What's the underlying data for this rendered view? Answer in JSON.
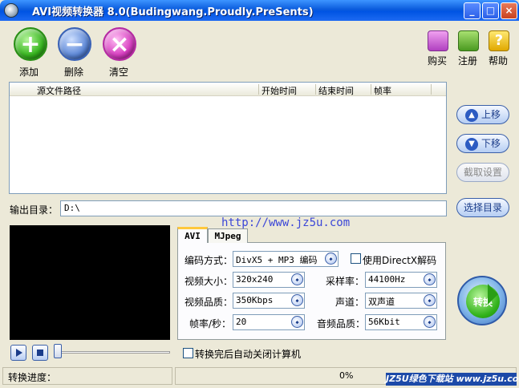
{
  "window": {
    "title": "AVI视频转换器 8.0(Budingwang.Proudly.PreSents)",
    "min_glyph": "_",
    "max_glyph": "□",
    "close_glyph": "×"
  },
  "toolbar": {
    "add_glyph": "+",
    "del_glyph": "−",
    "clr_glyph": "×",
    "add_label": "添加",
    "delete_label": "删除",
    "clear_label": "清空",
    "buy_label": "购买",
    "register_label": "注册",
    "help_label": "帮助",
    "help_glyph": "?"
  },
  "file_list": {
    "columns": [
      "源文件路径",
      "开始时间",
      "结束时间",
      "帧率"
    ],
    "rows": []
  },
  "side_buttons": {
    "up_label": "上移",
    "down_label": "下移",
    "capture_label": "截取设置",
    "choose_dir_label": "选择目录",
    "up_glyph": "▲",
    "down_glyph": "▼"
  },
  "output": {
    "label": "输出目录：",
    "value": "D:\\"
  },
  "watermark_url": "http://www.jz5u.com",
  "tabs": [
    "AVI",
    "MJpeg"
  ],
  "settings": {
    "codec_label": "编码方式：",
    "codec_value": "DivX5 + MP3 编码",
    "directx_label": "使用DirectX解码",
    "size_label": "视频大小：",
    "size_value": "320x240",
    "samplerate_label": "采样率：",
    "samplerate_value": "44100Hz",
    "quality_label": "视频品质：",
    "quality_value": "350Kbps",
    "channel_label": "声道：",
    "channel_value": "双声道",
    "fps_label": "帧率/秒：",
    "fps_value": "20",
    "audioq_label": "音频品质：",
    "audioq_value": "56Kbit",
    "combo_glyph": "◆"
  },
  "convert_label": "转换",
  "autoshut_label": "转换完后自动关闭计算机",
  "status": {
    "progress_label": "转换进度：",
    "progress_percent": "0%",
    "progress_value": 0,
    "badge_text": "JZ5U绿色下载站 www.jz5u.com"
  },
  "colors": {
    "titlebar": "#0054e3",
    "panel_bg": "#ece9d8",
    "link": "#3b46d8"
  }
}
